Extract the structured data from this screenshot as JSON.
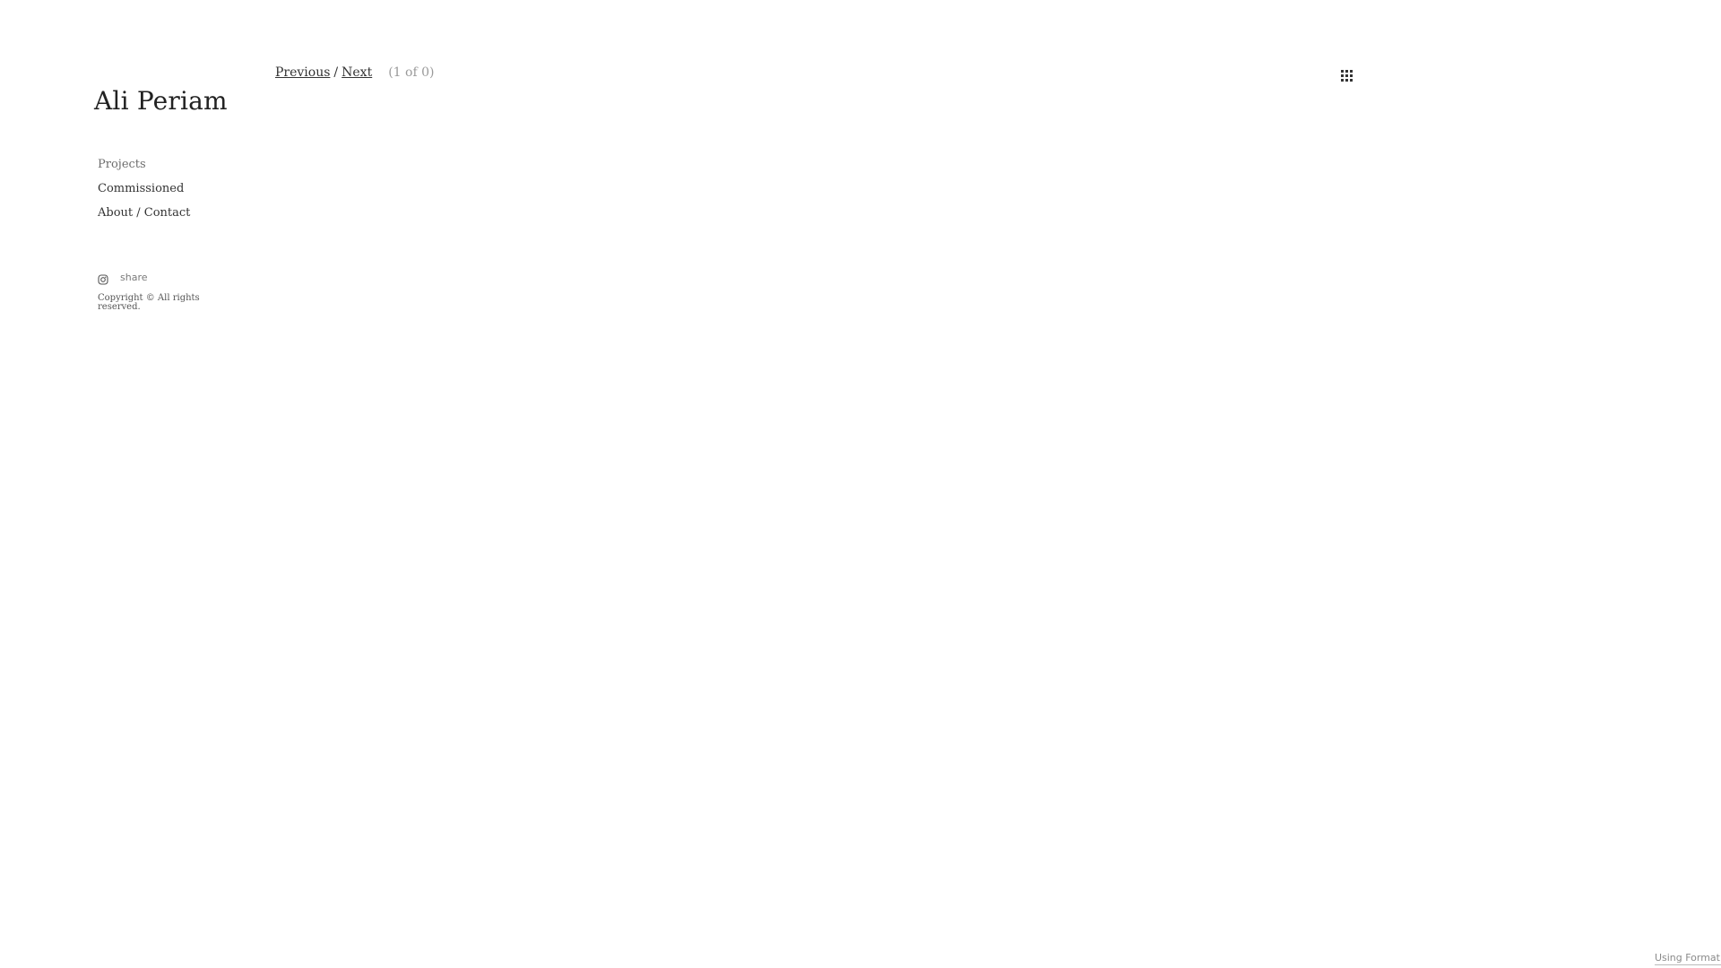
{
  "site": {
    "title": "Ali Periam"
  },
  "nav": {
    "items": [
      {
        "label": "Projects",
        "active": true
      },
      {
        "label": "Commissioned",
        "active": false
      },
      {
        "label": "About / Contact",
        "active": false
      }
    ]
  },
  "social": {
    "icon": "instagram-icon",
    "share_label": "share"
  },
  "copyright": "Copyright © All rights reserved.",
  "pager": {
    "previous_label": "Previous",
    "separator": "/",
    "next_label": "Next",
    "count_text": "(1 of 0)"
  },
  "grid_view": {
    "icon": "grid-icon"
  },
  "footer": {
    "using_format_label": "Using Format"
  },
  "colors": {
    "background": "#ffffff",
    "text": "#333333",
    "muted": "#9a9a9a"
  }
}
